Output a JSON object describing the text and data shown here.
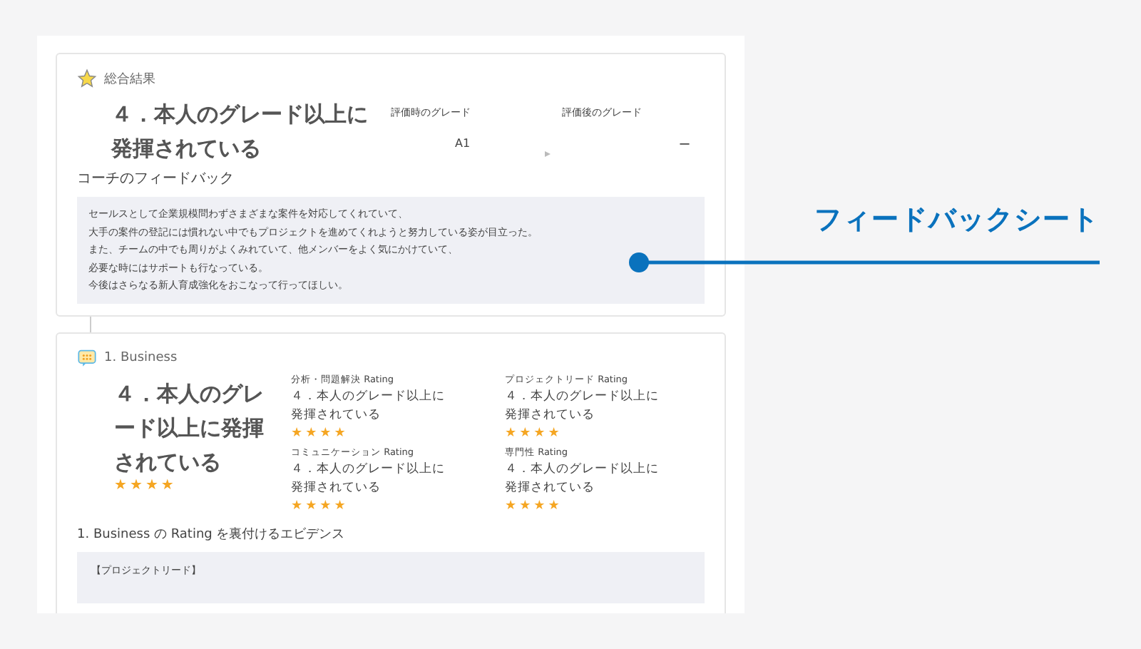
{
  "summary": {
    "title": "総合結果",
    "result": "４．本人のグレード以上に発揮されている",
    "grades": [
      {
        "label": "評価時のグレード",
        "value": "A1"
      },
      {
        "label": "評価後のグレード",
        "value": "ー"
      }
    ],
    "feedback_label": "コーチのフィードバック",
    "feedback_lines": [
      "セールスとして企業規模問わずさまざまな案件を対応してくれていて、",
      "大手の案件の登記には慣れない中でもプロジェクトを進めてくれようと努力している姿が目立った。",
      "また、チームの中でも周りがよくみれていて、他メンバーをよく気にかけていて、",
      "必要な時にはサポートも行なっている。",
      "今後はさらなる新人育成強化をおこなって行ってほしい。"
    ]
  },
  "business": {
    "title": "1. Business",
    "result": "４．本人のグレード以上に発揮されている",
    "stars": 4,
    "ratings": [
      {
        "label": "分析・問題解決 Rating",
        "value": "４．本人のグレード以上に発揮されている",
        "stars": 4
      },
      {
        "label": "プロジェクトリード Rating",
        "value": "４．本人のグレード以上に発揮されている",
        "stars": 4
      },
      {
        "label": "コミュニケーション Rating",
        "value": "４．本人のグレード以上に発揮されている",
        "stars": 4
      },
      {
        "label": "専門性 Rating",
        "value": "４．本人のグレード以上に発揮されている",
        "stars": 4
      }
    ],
    "evidence_label": "1. Business の Rating を裏付けるエビデンス",
    "evidence_text": "【プロジェクトリード】"
  },
  "callout": {
    "label": "フィードバックシート"
  }
}
